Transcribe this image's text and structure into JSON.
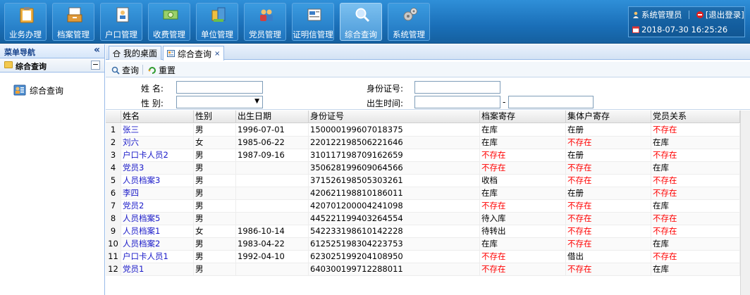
{
  "nav": {
    "items": [
      {
        "label": "业务办理",
        "icon": "clipboard-icon",
        "active": false
      },
      {
        "label": "档案管理",
        "icon": "archive-icon",
        "active": false
      },
      {
        "label": "户口管理",
        "icon": "household-register-icon",
        "active": false
      },
      {
        "label": "收费管理",
        "icon": "money-icon",
        "active": false
      },
      {
        "label": "单位管理",
        "icon": "organization-icon",
        "active": false
      },
      {
        "label": "党员管理",
        "icon": "people-icon",
        "active": false
      },
      {
        "label": "证明信管理",
        "icon": "letter-icon",
        "active": false
      },
      {
        "label": "综合查询",
        "icon": "search-icon",
        "active": true
      },
      {
        "label": "系统管理",
        "icon": "gears-icon",
        "active": false
      }
    ]
  },
  "user": {
    "name": "系统管理员",
    "logout": "[退出登录]",
    "datetime": "2018-07-30 16:25:26"
  },
  "sidebar": {
    "title": "菜单导航",
    "collapse": "«",
    "group": "综合查询",
    "group_toggle": "−",
    "item": "综合查询"
  },
  "tabs": {
    "home": "我的桌面",
    "current": "综合查询",
    "close": "×"
  },
  "toolbar": {
    "query": "查询",
    "reset": "重置"
  },
  "form": {
    "name_label": "姓 名:",
    "idno_label": "身份证号:",
    "gender_label": "性 别:",
    "birth_label": "出生时间:",
    "range_sep": "-",
    "name_value": "",
    "idno_value": "",
    "gender_value": "",
    "birth_from": "",
    "birth_to": ""
  },
  "grid": {
    "headers": [
      "姓名",
      "性别",
      "出生日期",
      "身份证号",
      "档案寄存",
      "集体户寄存",
      "党员关系"
    ],
    "rows": [
      {
        "no": "1",
        "name": "张三",
        "gender": "男",
        "birth": "1996-07-01",
        "idno": "150000199607018375",
        "archive": "在库",
        "collective": "在册",
        "party": "不存在"
      },
      {
        "no": "2",
        "name": "刘六",
        "gender": "女",
        "birth": "1985-06-22",
        "idno": "220122198506221646",
        "archive": "在库",
        "collective": "不存在",
        "party": "在库"
      },
      {
        "no": "3",
        "name": "户口卡人员2",
        "gender": "男",
        "birth": "1987-09-16",
        "idno": "310117198709162659",
        "archive": "不存在",
        "collective": "在册",
        "party": "不存在"
      },
      {
        "no": "4",
        "name": "党员3",
        "gender": "男",
        "birth": "",
        "idno": "350628199609064566",
        "archive": "不存在",
        "collective": "不存在",
        "party": "在库"
      },
      {
        "no": "5",
        "name": "人员档案3",
        "gender": "男",
        "birth": "",
        "idno": "371526198505303261",
        "archive": "收档",
        "collective": "不存在",
        "party": "不存在"
      },
      {
        "no": "6",
        "name": "李四",
        "gender": "男",
        "birth": "",
        "idno": "420621198810186011",
        "archive": "在库",
        "collective": "在册",
        "party": "不存在"
      },
      {
        "no": "7",
        "name": "党员2",
        "gender": "男",
        "birth": "",
        "idno": "420701200004241098",
        "archive": "不存在",
        "collective": "不存在",
        "party": "在库"
      },
      {
        "no": "8",
        "name": "人员档案5",
        "gender": "男",
        "birth": "",
        "idno": "445221199403264554",
        "archive": "待入库",
        "collective": "不存在",
        "party": "不存在"
      },
      {
        "no": "9",
        "name": "人员档案1",
        "gender": "女",
        "birth": "1986-10-14",
        "idno": "542233198610142228",
        "archive": "待转出",
        "collective": "不存在",
        "party": "不存在"
      },
      {
        "no": "10",
        "name": "人员档案2",
        "gender": "男",
        "birth": "1983-04-22",
        "idno": "612525198304223753",
        "archive": "在库",
        "collective": "不存在",
        "party": "在库"
      },
      {
        "no": "11",
        "name": "户口卡人员1",
        "gender": "男",
        "birth": "1992-04-10",
        "idno": "623025199204108950",
        "archive": "不存在",
        "collective": "借出",
        "party": "不存在"
      },
      {
        "no": "12",
        "name": "党员1",
        "gender": "男",
        "birth": "",
        "idno": "640300199712288011",
        "archive": "不存在",
        "collective": "不存在",
        "party": "在库"
      }
    ]
  },
  "colors": {
    "accent": "#1a6fb8",
    "link": "#1919c8",
    "missing": "#ff0000"
  }
}
